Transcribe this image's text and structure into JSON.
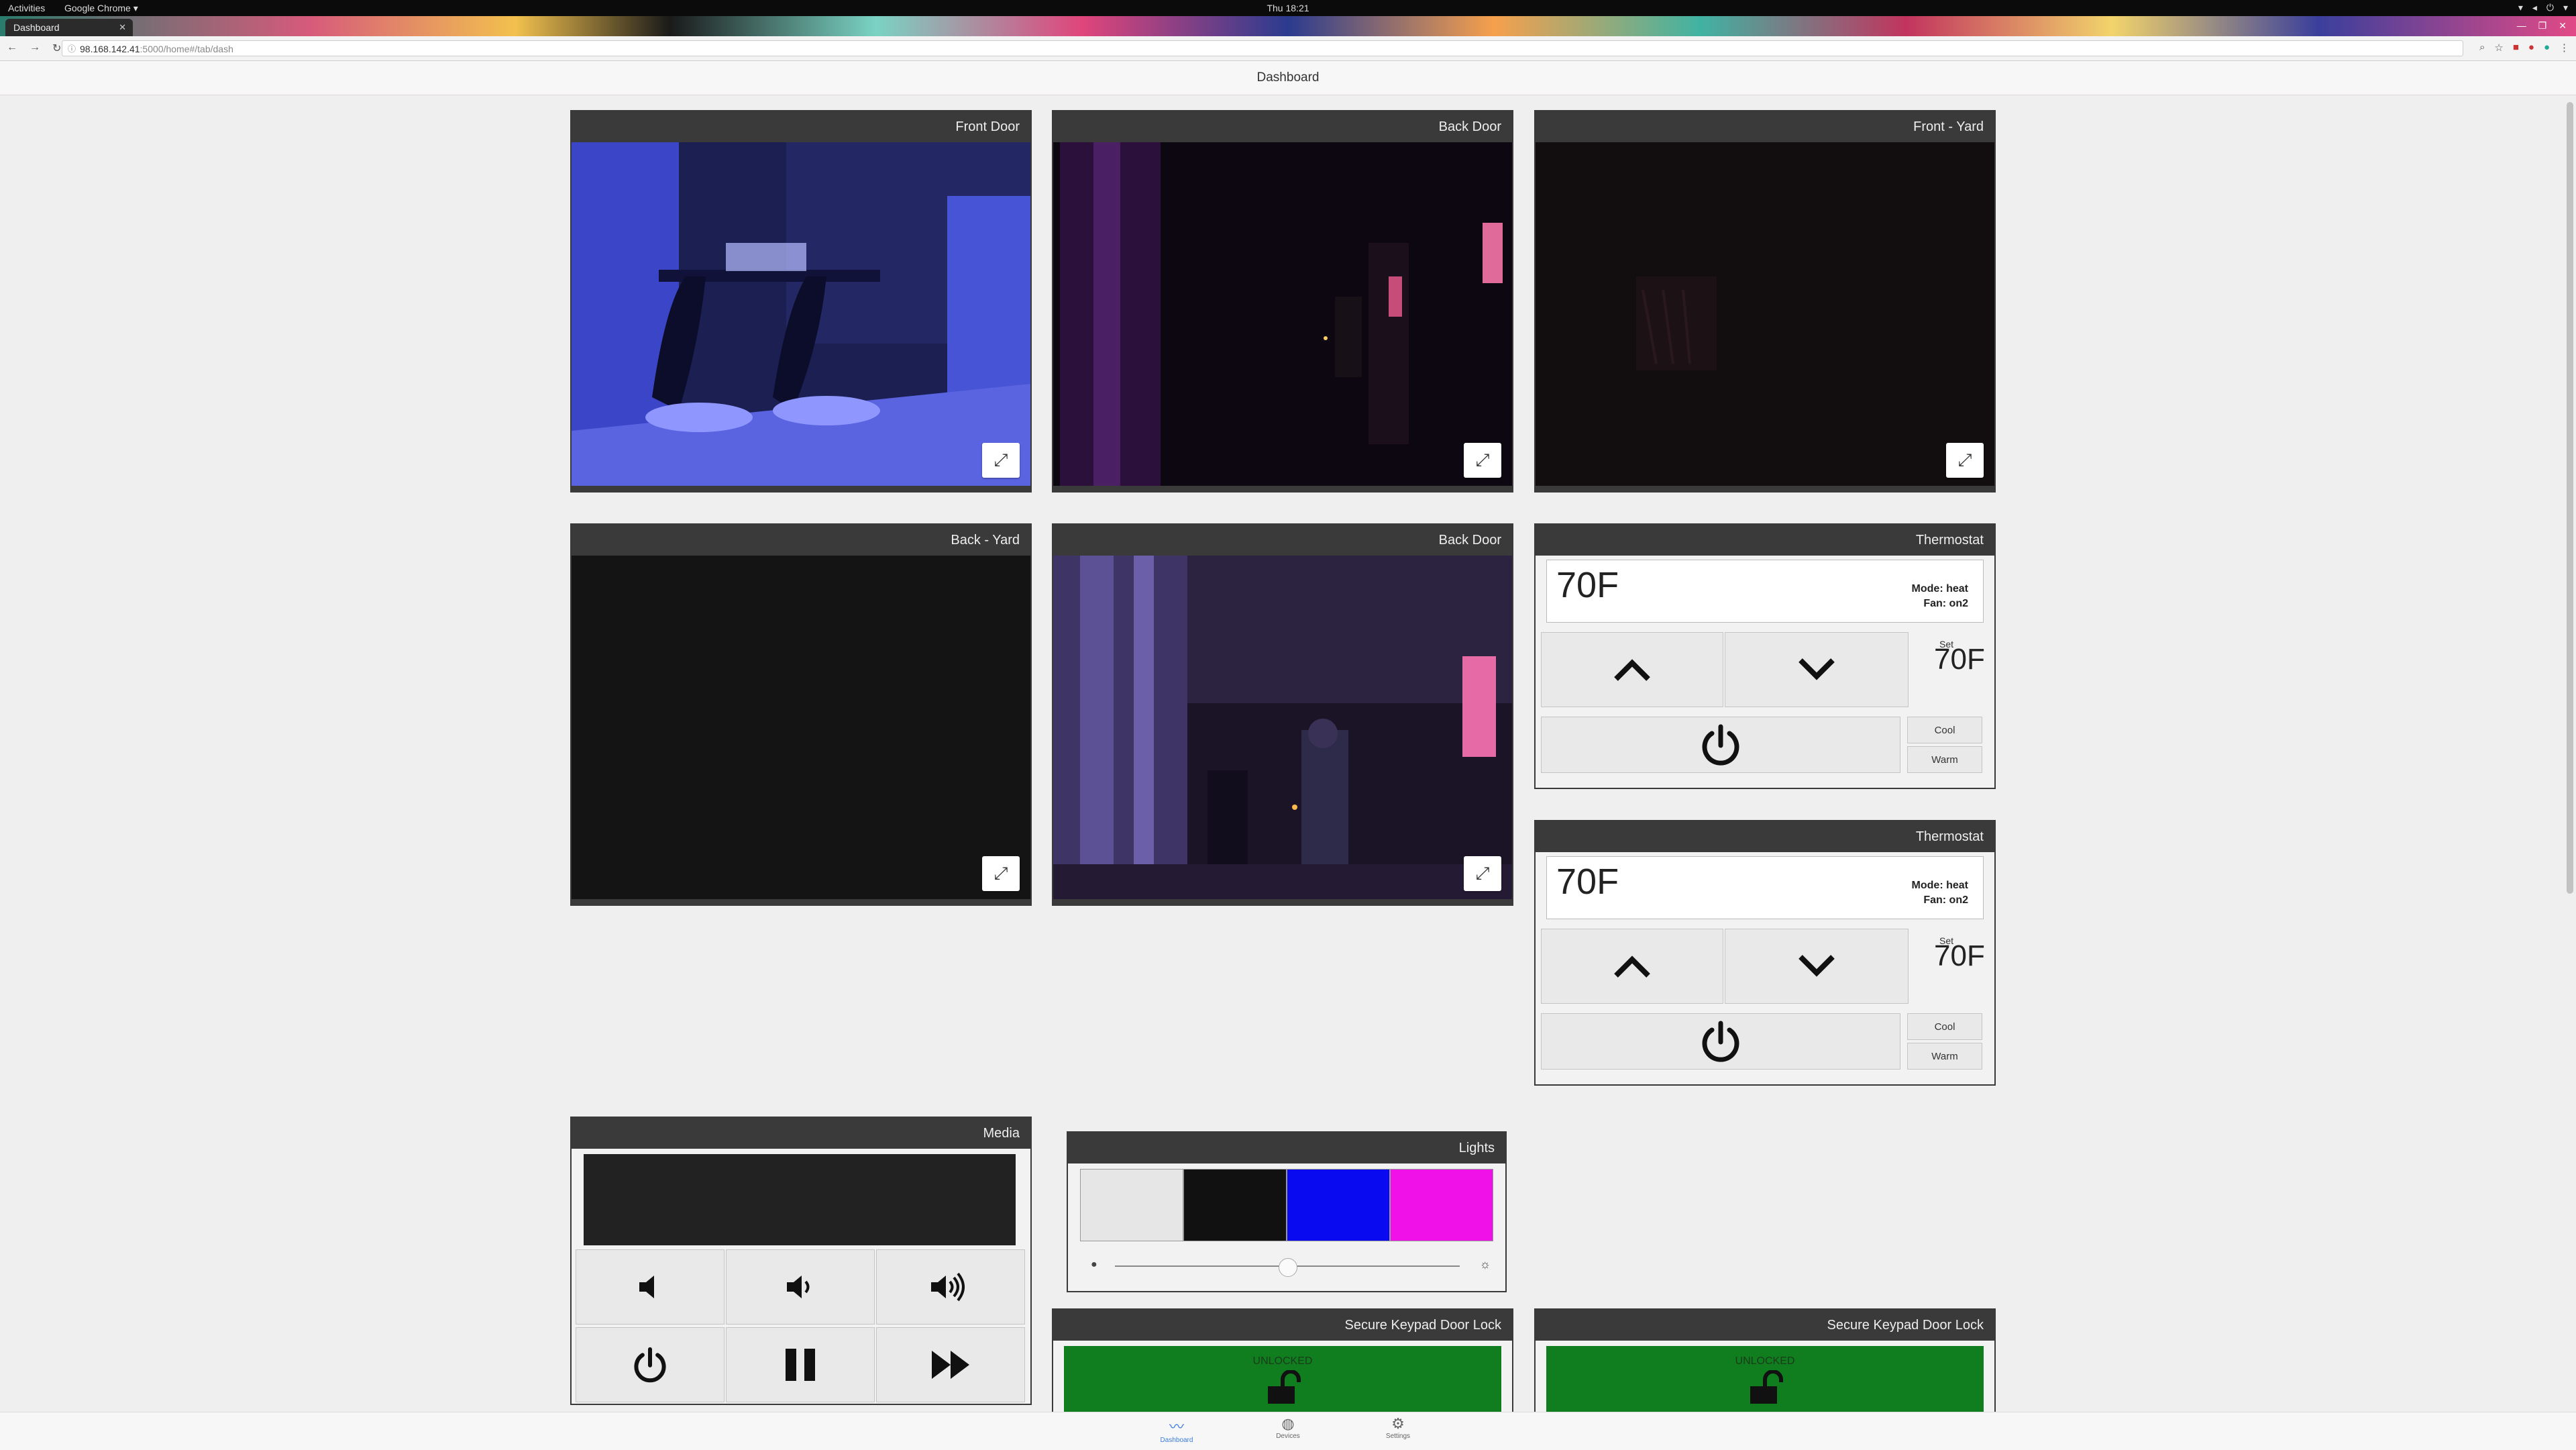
{
  "os": {
    "activities": "Activities",
    "app_menu": "Google Chrome ▾",
    "clock": "Thu 18:21"
  },
  "browser": {
    "tab_title": "Dashboard",
    "url_host": "98.168.142.41",
    "url_path": ":5000/home#/tab/dash"
  },
  "page": {
    "title": "Dashboard"
  },
  "cameras": [
    {
      "title": "Front Door"
    },
    {
      "title": "Back Door"
    },
    {
      "title": "Front - Yard"
    },
    {
      "title": "Back - Yard"
    },
    {
      "title": "Back Door"
    }
  ],
  "thermostats": [
    {
      "title": "Thermostat",
      "current": "70F",
      "mode": "Mode: heat",
      "fan": "Fan: on2",
      "set_label": "Set",
      "set_value": "70F",
      "cool_label": "Cool",
      "warm_label": "Warm"
    },
    {
      "title": "Thermostat",
      "current": "70F",
      "mode": "Mode: heat",
      "fan": "Fan: on2",
      "set_label": "Set",
      "set_value": "70F",
      "cool_label": "Cool",
      "warm_label": "Warm"
    }
  ],
  "media": {
    "title": "Media"
  },
  "lights": {
    "title": "Lights",
    "swatches": [
      "#e6e6e6",
      "#111111",
      "#0a0af0",
      "#f010e8"
    ],
    "brightness": 0.5
  },
  "locks": [
    {
      "title": "Secure Keypad Door Lock",
      "status": "UNLOCKED",
      "color": "#107d1f"
    },
    {
      "title": "Secure Keypad Door Lock",
      "status": "UNLOCKED",
      "color": "#107d1f"
    }
  ],
  "bottom_nav": {
    "dashboard": "Dashboard",
    "devices": "Devices",
    "settings": "Settings"
  }
}
